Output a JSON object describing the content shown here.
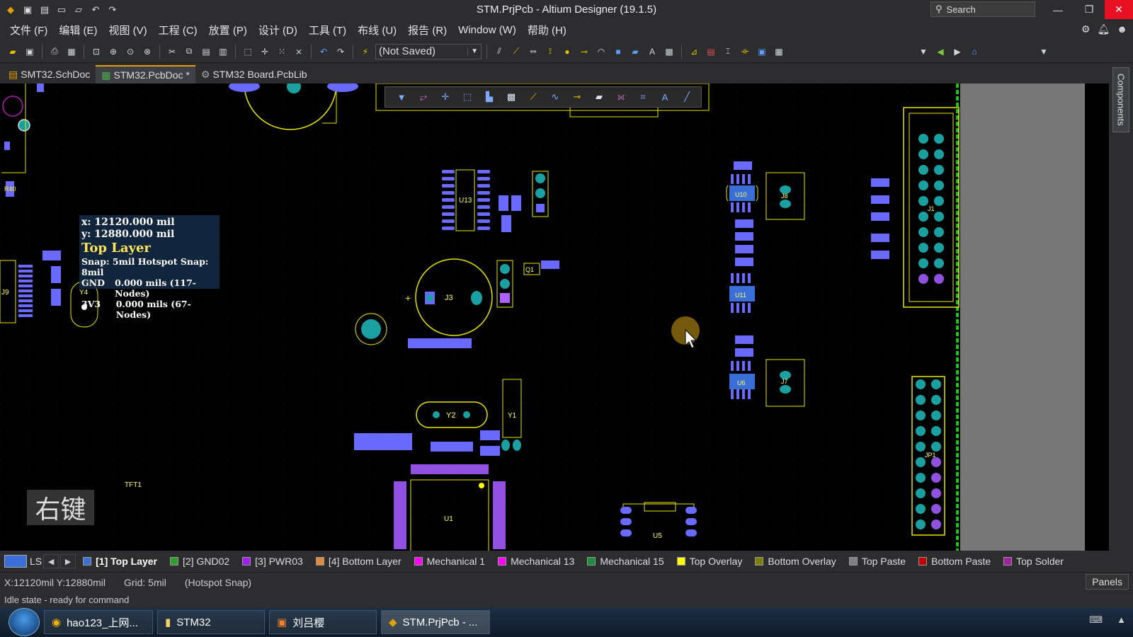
{
  "window": {
    "title": "STM.PrjPcb - Altium Designer (19.1.5)",
    "search_placeholder": "Search"
  },
  "menu": [
    "文件 (F)",
    "编辑 (E)",
    "视图 (V)",
    "工程 (C)",
    "放置 (P)",
    "设计 (D)",
    "工具 (T)",
    "布线 (U)",
    "报告 (R)",
    "Window (W)",
    "帮助 (H)"
  ],
  "toolbar": {
    "save_state": "(Not Saved)"
  },
  "doc_tabs": [
    "SMT32.SchDoc",
    "STM32.PcbDoc *",
    "STM32 Board.PcbLib"
  ],
  "right_panel_tab": "Components",
  "tooltip": {
    "x": "x: 12120.000 mil",
    "y": "y: 12880.000 mil",
    "layer": "Top Layer",
    "snap": "Snap: 5mil Hotspot Snap: 8mil",
    "nets": [
      {
        "name": "GND",
        "value": "0.000 mils (117-Nodes)"
      },
      {
        "name": "3V3",
        "value": "0.000 mils (67-Nodes)"
      }
    ]
  },
  "overlay_label": "右键",
  "components": {
    "u13": "U13",
    "j3": "J3",
    "y2": "Y2",
    "y1": "Y1",
    "u1": "U1",
    "u5": "U5",
    "u10": "U10",
    "u11": "U11",
    "u6": "U6",
    "j8": "J8",
    "j7": "J7",
    "j1": "J1",
    "jp1": "JP1",
    "q1": "Q1",
    "y4": "Y4",
    "tft1": "TFT1",
    "j9": "J9",
    "r40": "R40"
  },
  "layer_tabs": {
    "ls": "LS",
    "layers": [
      {
        "label": "[1] Top Layer",
        "color": "#3a6fd8",
        "active": true
      },
      {
        "label": "[2] GND02",
        "color": "#2f9e2f",
        "active": false
      },
      {
        "label": "[3] PWR03",
        "color": "#a020f0",
        "active": false
      },
      {
        "label": "[4] Bottom Layer",
        "color": "#e08a3a",
        "active": false
      },
      {
        "label": "Mechanical 1",
        "color": "#ff00ff",
        "active": false
      },
      {
        "label": "Mechanical 13",
        "color": "#ff00ff",
        "active": false
      },
      {
        "label": "Mechanical 15",
        "color": "#1e8e3e",
        "active": false
      },
      {
        "label": "Top Overlay",
        "color": "#ffff00",
        "active": false
      },
      {
        "label": "Bottom Overlay",
        "color": "#808000",
        "active": false
      },
      {
        "label": "Top Paste",
        "color": "#808080",
        "active": false
      },
      {
        "label": "Bottom Paste",
        "color": "#c00000",
        "active": false
      },
      {
        "label": "Top Solder",
        "color": "#a020a0",
        "active": false
      }
    ]
  },
  "status": {
    "coords": "X:12120mil Y:12880mil",
    "grid": "Grid: 5mil",
    "snap": "(Hotspot Snap)",
    "panels_button": "Panels",
    "idle": "Idle state - ready for command"
  },
  "taskbar": [
    {
      "label": "hao123_上网...",
      "active": false
    },
    {
      "label": "STM32",
      "active": false
    },
    {
      "label": "刘吕樱",
      "active": false
    },
    {
      "label": "STM.PrjPcb - ...",
      "active": true
    }
  ]
}
